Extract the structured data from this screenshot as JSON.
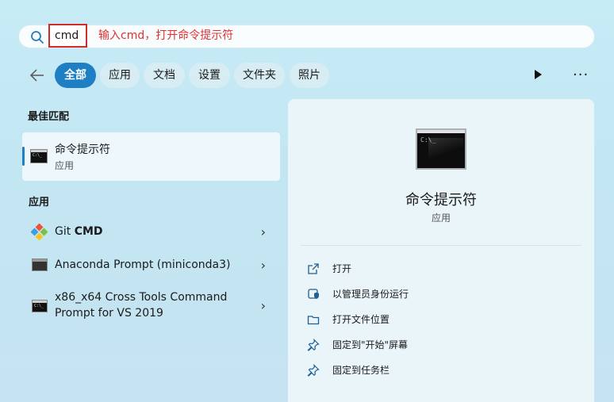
{
  "search": {
    "query": "cmd",
    "annotation": "输入cmd，打开命令提示符"
  },
  "filters": {
    "items": [
      {
        "label": "全部",
        "active": true
      },
      {
        "label": "应用",
        "active": false
      },
      {
        "label": "文档",
        "active": false
      },
      {
        "label": "设置",
        "active": false
      },
      {
        "label": "文件夹",
        "active": false
      },
      {
        "label": "照片",
        "active": false
      }
    ],
    "more_label": "···"
  },
  "best_match": {
    "heading": "最佳匹配",
    "title": "命令提示符",
    "subtitle": "应用"
  },
  "apps": {
    "heading": "应用",
    "items": [
      {
        "prefix": "Git ",
        "bold": "CMD",
        "icon": "git-icon"
      },
      {
        "label": "Anaconda Prompt (miniconda3)",
        "icon": "anaconda-prompt-icon"
      },
      {
        "line1": "x86_x64 Cross Tools Command",
        "line2": "Prompt for VS 2019",
        "icon": "cmd-icon"
      }
    ]
  },
  "detail": {
    "title": "命令提示符",
    "subtitle": "应用",
    "actions": [
      {
        "label": "打开",
        "icon": "open-icon"
      },
      {
        "label": "以管理员身份运行",
        "icon": "shield-admin-icon"
      },
      {
        "label": "打开文件位置",
        "icon": "folder-icon"
      },
      {
        "label": "固定到\"开始\"屏幕",
        "icon": "pin-icon"
      },
      {
        "label": "固定到任务栏",
        "icon": "pin-icon"
      }
    ]
  },
  "colors": {
    "accent": "#1e7fc4",
    "annotation": "#e03131"
  }
}
